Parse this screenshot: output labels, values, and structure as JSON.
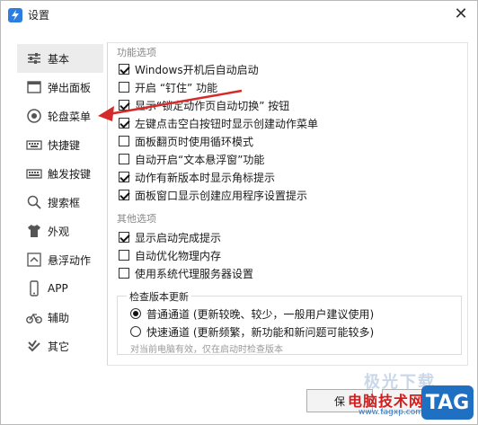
{
  "window": {
    "title": "设置"
  },
  "sidebar": {
    "items": [
      {
        "label": "基本",
        "icon": "sliders-icon",
        "active": true
      },
      {
        "label": "弹出面板",
        "icon": "panel-icon"
      },
      {
        "label": "轮盘菜单",
        "icon": "wheel-icon"
      },
      {
        "label": "快捷键",
        "icon": "keyboard-icon"
      },
      {
        "label": "触发按键",
        "icon": "keyboard-trigger-icon"
      },
      {
        "label": "搜索框",
        "icon": "search-icon"
      },
      {
        "label": "外观",
        "icon": "shirt-icon"
      },
      {
        "label": "悬浮动作",
        "icon": "float-icon"
      },
      {
        "label": "APP",
        "icon": "app-icon"
      },
      {
        "label": "辅助",
        "icon": "bike-icon"
      },
      {
        "label": "其它",
        "icon": "more-icon"
      }
    ]
  },
  "sections": {
    "function_options": {
      "title": "功能选项",
      "items": [
        {
          "label": "Windows开机后自动启动",
          "checked": true
        },
        {
          "label": "开启 “钉住” 功能",
          "checked": false
        },
        {
          "label": "显示“锁定动作页自动切换” 按钮",
          "checked": true
        },
        {
          "label": "左键点击空白按钮时显示创建动作菜单",
          "checked": true
        },
        {
          "label": "面板翻页时使用循环模式",
          "checked": false
        },
        {
          "label": "自动开启“文本悬浮窗”功能",
          "checked": false
        },
        {
          "label": "动作有新版本时显示角标提示",
          "checked": true
        },
        {
          "label": "面板窗口显示创建应用程序设置提示",
          "checked": true
        }
      ]
    },
    "other_options": {
      "title": "其他选项",
      "items": [
        {
          "label": "显示启动完成提示",
          "checked": true
        },
        {
          "label": "自动优化物理内存",
          "checked": false
        },
        {
          "label": "使用系统代理服务器设置",
          "checked": false
        }
      ]
    },
    "update_check": {
      "title": "检查版本更新",
      "options": [
        {
          "label": "普通通道 (更新较晚、较少，一般用户建议使用)",
          "selected": true
        },
        {
          "label": "快速通道 (更新频繁，新功能和新问题可能较多)",
          "selected": false
        }
      ],
      "note": "对当前电脑有效，仅在启动时检查版本"
    }
  },
  "footer": {
    "save_label": "保"
  },
  "watermark": {
    "site": "电脑技术网",
    "url": "www.tagxp.com",
    "tag": "TAG",
    "faint": "极光下载"
  },
  "colors": {
    "arrow": "#d42a2a",
    "active_bg": "#ececec",
    "tag_bg": "#1f6fc3"
  }
}
